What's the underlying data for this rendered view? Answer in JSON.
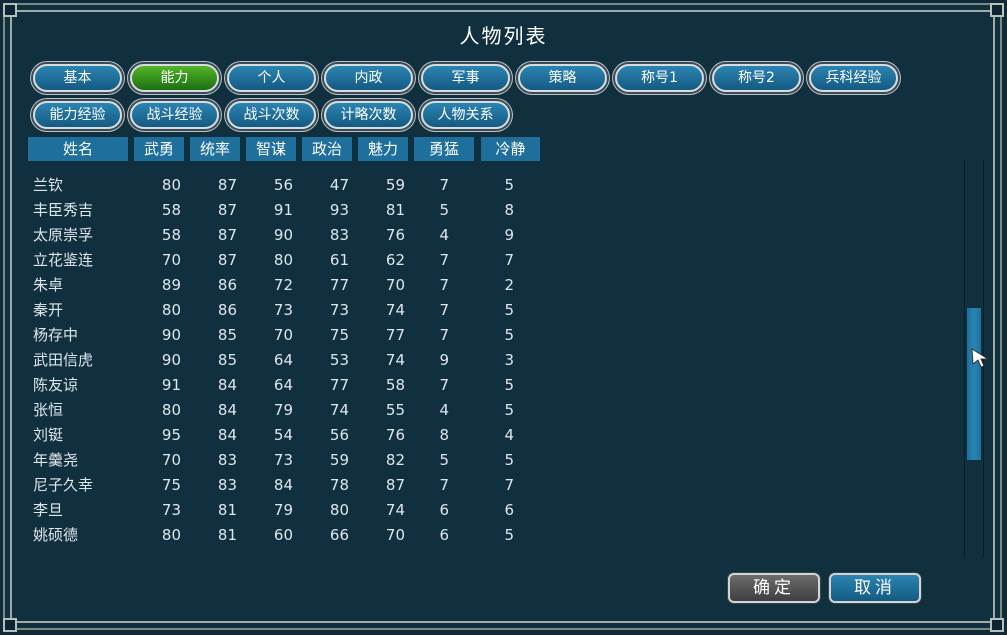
{
  "window": {
    "title": "人物列表"
  },
  "tabs_row1": [
    {
      "label": "基本",
      "active": false
    },
    {
      "label": "能力",
      "active": true
    },
    {
      "label": "个人",
      "active": false
    },
    {
      "label": "内政",
      "active": false
    },
    {
      "label": "军事",
      "active": false
    },
    {
      "label": "策略",
      "active": false
    },
    {
      "label": "称号1",
      "active": false
    },
    {
      "label": "称号2",
      "active": false
    },
    {
      "label": "兵科经验",
      "active": false
    }
  ],
  "tabs_row2": [
    {
      "label": "能力经验",
      "active": false
    },
    {
      "label": "战斗经验",
      "active": false
    },
    {
      "label": "战斗次数",
      "active": false
    },
    {
      "label": "计略次数",
      "active": false
    },
    {
      "label": "人物关系",
      "active": false
    }
  ],
  "columns": [
    "姓名",
    "武勇",
    "统率",
    "智谋",
    "政治",
    "魅力",
    "勇猛",
    "冷静"
  ],
  "rows": [
    {
      "name": "兰钦",
      "vals": [
        "80",
        "87",
        "56",
        "47",
        "59",
        "7",
        "5"
      ]
    },
    {
      "name": "丰臣秀吉",
      "vals": [
        "58",
        "87",
        "91",
        "93",
        "81",
        "5",
        "8"
      ]
    },
    {
      "name": "太原崇孚",
      "vals": [
        "58",
        "87",
        "90",
        "83",
        "76",
        "4",
        "9"
      ]
    },
    {
      "name": "立花鉴连",
      "vals": [
        "70",
        "87",
        "80",
        "61",
        "62",
        "7",
        "7"
      ]
    },
    {
      "name": "朱卓",
      "vals": [
        "89",
        "86",
        "72",
        "77",
        "70",
        "7",
        "2"
      ]
    },
    {
      "name": "秦开",
      "vals": [
        "80",
        "86",
        "73",
        "73",
        "74",
        "7",
        "5"
      ]
    },
    {
      "name": "杨存中",
      "vals": [
        "90",
        "85",
        "70",
        "75",
        "77",
        "7",
        "5"
      ]
    },
    {
      "name": "武田信虎",
      "vals": [
        "90",
        "85",
        "64",
        "53",
        "74",
        "9",
        "3"
      ]
    },
    {
      "name": "陈友谅",
      "vals": [
        "91",
        "84",
        "64",
        "77",
        "58",
        "7",
        "5"
      ]
    },
    {
      "name": "张恒",
      "vals": [
        "80",
        "84",
        "79",
        "74",
        "55",
        "4",
        "5"
      ]
    },
    {
      "name": "刘铤",
      "vals": [
        "95",
        "84",
        "54",
        "56",
        "76",
        "8",
        "4"
      ]
    },
    {
      "name": "年羹尧",
      "vals": [
        "70",
        "83",
        "73",
        "59",
        "82",
        "5",
        "5"
      ]
    },
    {
      "name": "尼子久幸",
      "vals": [
        "75",
        "83",
        "84",
        "78",
        "87",
        "7",
        "7"
      ]
    },
    {
      "name": "李旦",
      "vals": [
        "73",
        "81",
        "79",
        "80",
        "74",
        "6",
        "6"
      ]
    },
    {
      "name": "姚硕德",
      "vals": [
        "80",
        "81",
        "60",
        "66",
        "70",
        "6",
        "5"
      ]
    }
  ],
  "buttons": {
    "confirm": "确定",
    "cancel": "取消"
  },
  "colors": {
    "tab_blue": "#1f6f9c",
    "tab_active_green": "#3a9a22",
    "header_blue": "#1e6f9c",
    "background": "#11303f"
  }
}
